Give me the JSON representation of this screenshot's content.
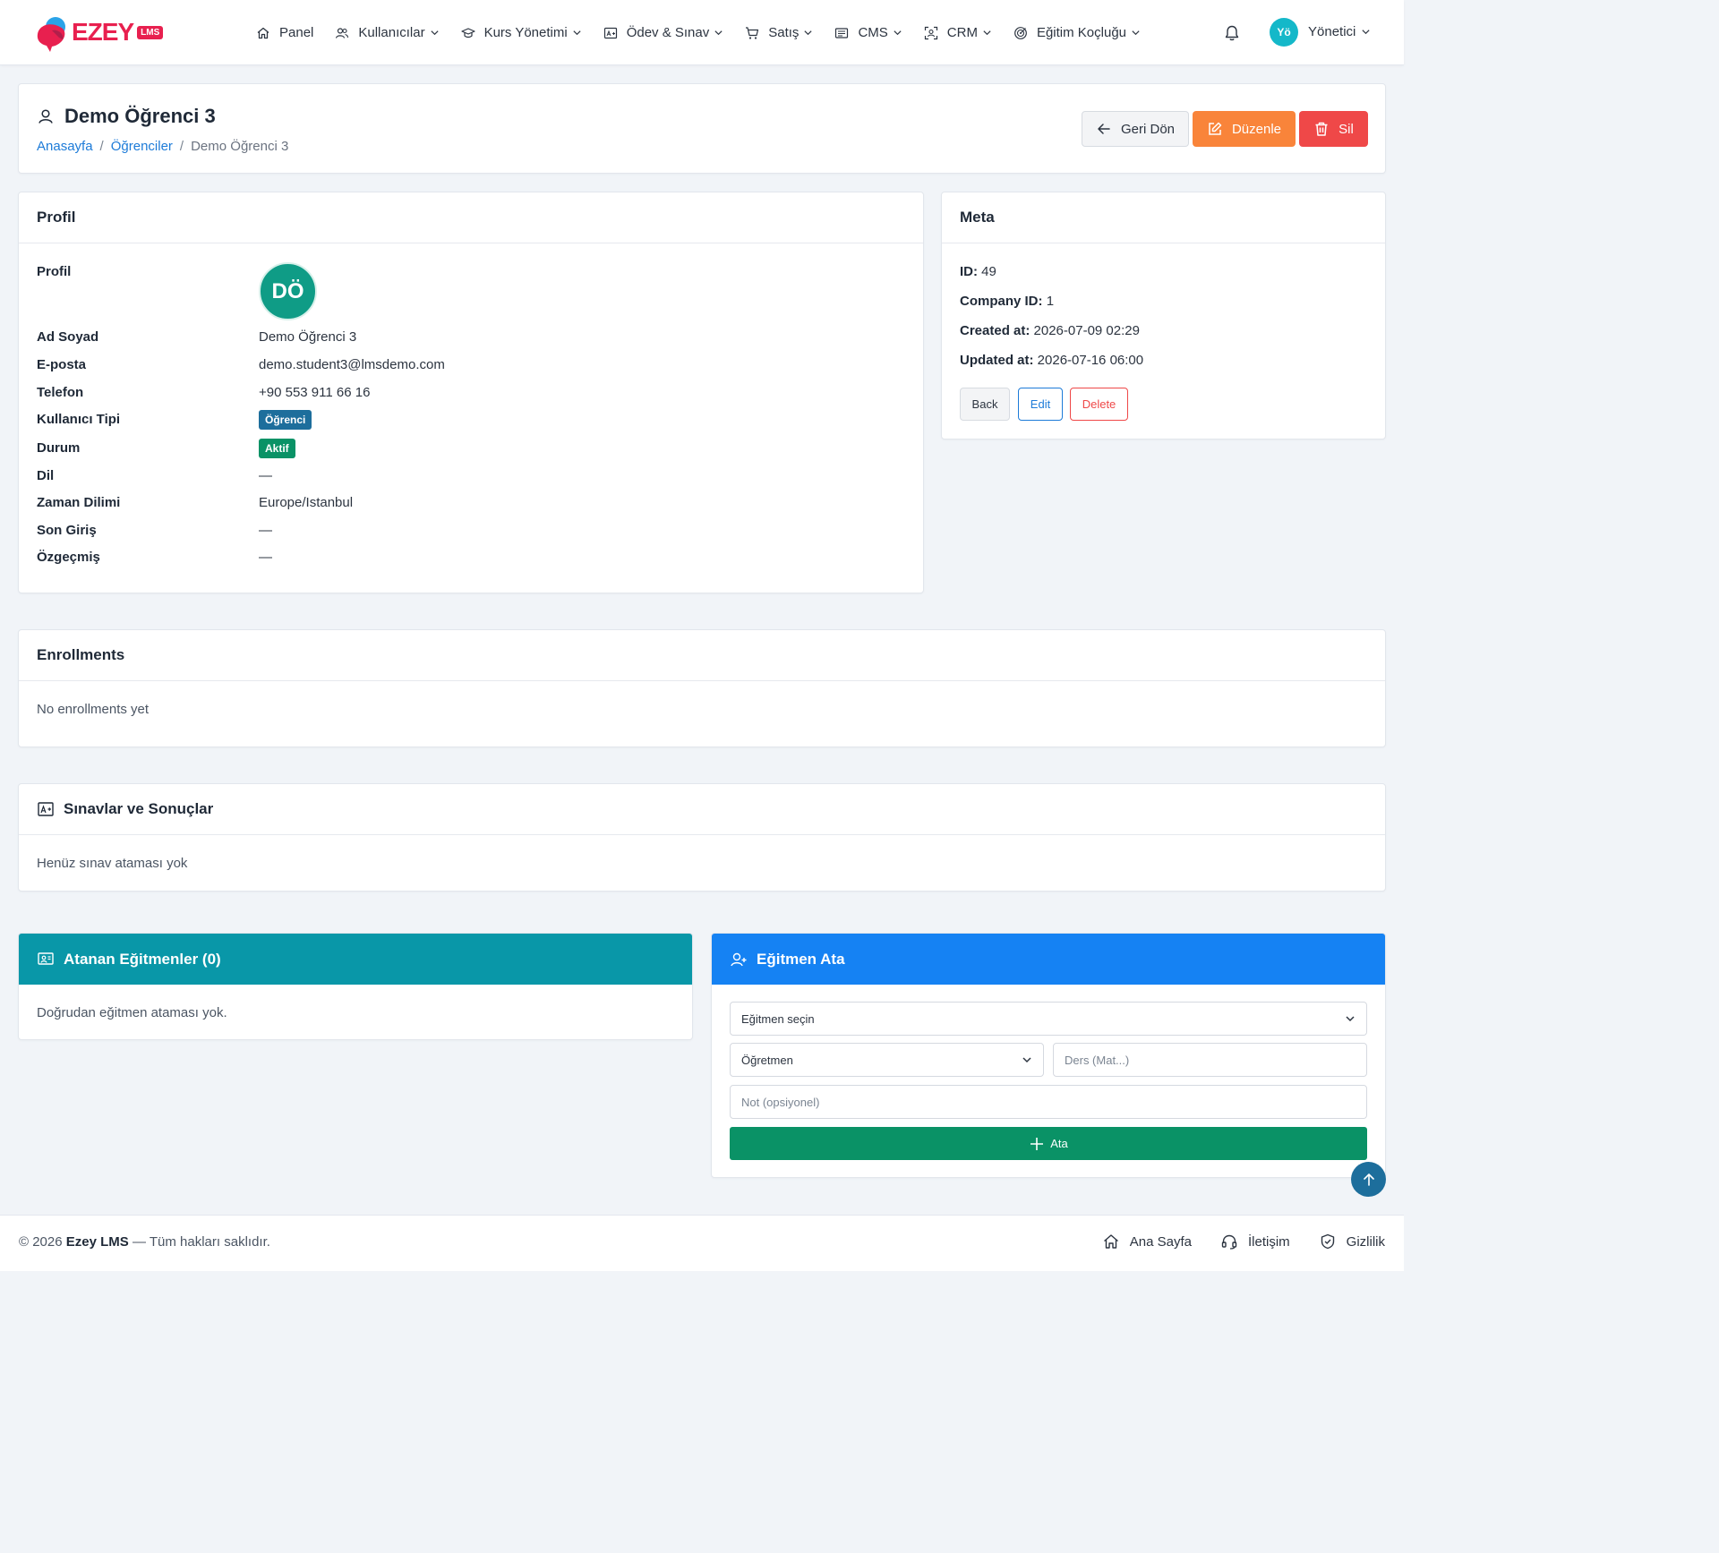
{
  "brand": {
    "name": "EZEY",
    "badge": "LMS",
    "accent": "#e8204f"
  },
  "nav": {
    "items": [
      {
        "label": "Panel",
        "icon": "home-icon",
        "dropdown": false
      },
      {
        "label": "Kullanıcılar",
        "icon": "users-icon",
        "dropdown": true
      },
      {
        "label": "Kurs Yönetimi",
        "icon": "graduation-cap-icon",
        "dropdown": true
      },
      {
        "label": "Ödev & Sınav",
        "icon": "exam-icon",
        "dropdown": true
      },
      {
        "label": "Satış",
        "icon": "cart-icon",
        "dropdown": true
      },
      {
        "label": "CMS",
        "icon": "cms-icon",
        "dropdown": true
      },
      {
        "label": "CRM",
        "icon": "crm-icon",
        "dropdown": true
      },
      {
        "label": "Eğitim Koçluğu",
        "icon": "target-icon",
        "dropdown": true
      }
    ],
    "user": {
      "initials": "Yö",
      "name": "Yönetici"
    }
  },
  "header": {
    "title": "Demo Öğrenci 3",
    "breadcrumb": [
      "Anasayfa",
      "Öğrenciler",
      "Demo Öğrenci 3"
    ],
    "back_label": "Geri Dön",
    "edit_label": "Düzenle",
    "delete_label": "Sil"
  },
  "profile": {
    "title": "Profil",
    "avatar_label": "Profil",
    "initials": "DÖ",
    "fields": [
      {
        "label": "Ad Soyad",
        "value": "Demo Öğrenci 3"
      },
      {
        "label": "E-posta",
        "value": "demo.student3@lmsdemo.com"
      },
      {
        "label": "Telefon",
        "value": "+90 553 911 66 16"
      },
      {
        "label": "Kullanıcı Tipi",
        "value": "Öğrenci",
        "badge_color": "#1d6e9c"
      },
      {
        "label": "Durum",
        "value": "Aktif",
        "badge_color": "#0a9266"
      },
      {
        "label": "Dil",
        "value": "—"
      },
      {
        "label": "Zaman Dilimi",
        "value": "Europe/Istanbul"
      },
      {
        "label": "Son Giriş",
        "value": "—"
      },
      {
        "label": "Özgeçmiş",
        "value": "—"
      }
    ]
  },
  "meta": {
    "title": "Meta",
    "rows": [
      {
        "label": "ID:",
        "value": "49"
      },
      {
        "label": "Company ID:",
        "value": "1"
      },
      {
        "label": "Created at:",
        "value": "2026-07-09 02:29"
      },
      {
        "label": "Updated at:",
        "value": "2026-07-16 06:00"
      }
    ],
    "back_label": "Back",
    "edit_label": "Edit",
    "delete_label": "Delete"
  },
  "enrollments": {
    "title": "Enrollments",
    "empty": "No enrollments yet"
  },
  "exams": {
    "title": "Sınavlar ve Sonuçlar",
    "empty": "Henüz sınav ataması yok"
  },
  "assigned": {
    "title": "Atanan Eğitmenler (0)",
    "empty": "Doğrudan eğitmen ataması yok.",
    "color": "#0997a8"
  },
  "assign": {
    "title": "Eğitmen Ata",
    "color": "#1582f3",
    "instructor_select": "Eğitmen seçin",
    "role_select": "Öğretmen",
    "course_placeholder": "Ders (Mat...)",
    "note_placeholder": "Not (opsiyonel)",
    "submit_label": "Ata"
  },
  "footer": {
    "year": "© 2026",
    "brand": "Ezey LMS",
    "rights": "— Tüm hakları saklıdır.",
    "links": [
      {
        "label": "Ana Sayfa",
        "icon": "home-icon"
      },
      {
        "label": "İletişim",
        "icon": "headset-icon"
      },
      {
        "label": "Gizlilik",
        "icon": "shield-icon"
      }
    ]
  }
}
